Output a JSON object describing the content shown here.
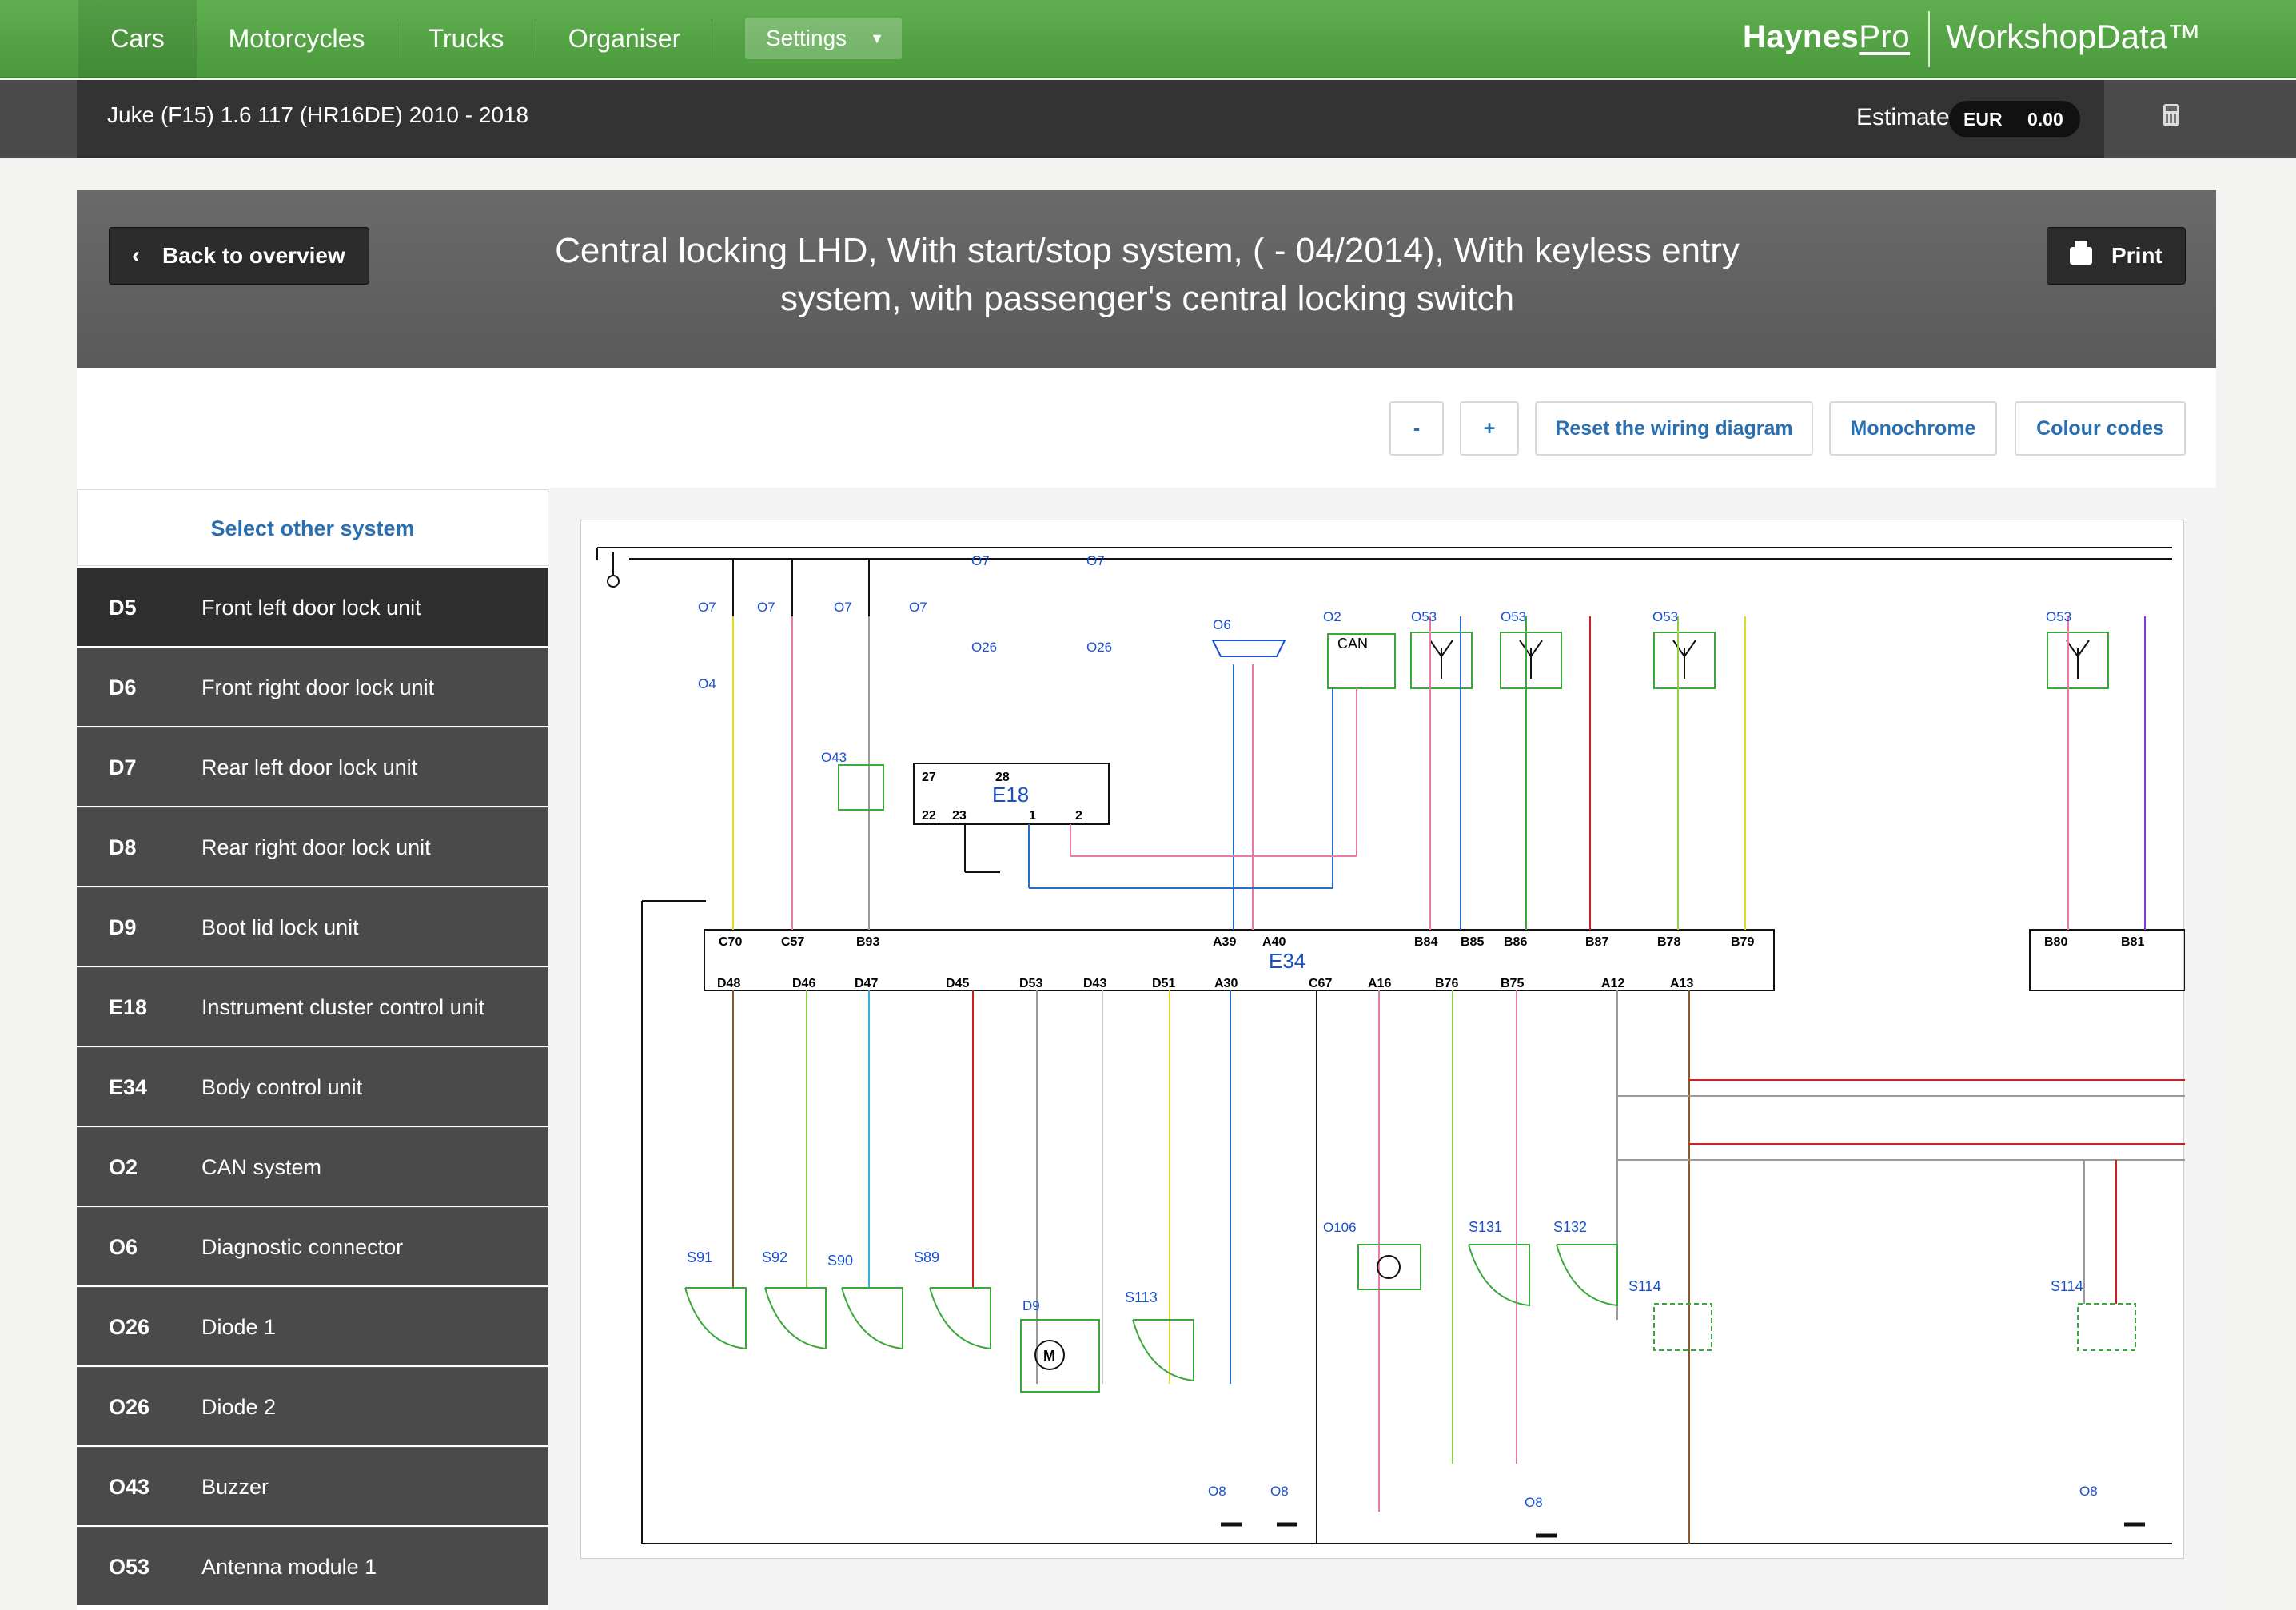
{
  "nav": {
    "items": [
      "Cars",
      "Motorcycles",
      "Trucks",
      "Organiser"
    ],
    "settings_label": "Settings",
    "brand_main": "Haynes",
    "brand_pro": "Pro",
    "brand_product": "WorkshopData™"
  },
  "vehicle": {
    "title": "Juke (F15) 1.6 117 (HR16DE) 2010 - 2018",
    "estimate_label": "Estimate",
    "currency": "EUR",
    "amount": "0.00"
  },
  "header": {
    "back_label": "Back to overview",
    "print_label": "Print",
    "title": "Central locking LHD, With start/stop system, ( - 04/2014), With keyless entry system, with passenger's central locking switch"
  },
  "toolbar": {
    "zoom_out": "-",
    "zoom_in": "+",
    "reset": "Reset the wiring diagram",
    "monochrome": "Monochrome",
    "colour_codes": "Colour codes"
  },
  "sidebar": {
    "select_other": "Select other system",
    "items": [
      {
        "code": "D5",
        "name": "Front left door lock unit"
      },
      {
        "code": "D6",
        "name": "Front right door lock unit"
      },
      {
        "code": "D7",
        "name": "Rear left door lock unit"
      },
      {
        "code": "D8",
        "name": "Rear right door lock unit"
      },
      {
        "code": "D9",
        "name": "Boot lid lock unit"
      },
      {
        "code": "E18",
        "name": "Instrument cluster control unit"
      },
      {
        "code": "E34",
        "name": "Body control unit"
      },
      {
        "code": "O2",
        "name": "CAN system"
      },
      {
        "code": "O6",
        "name": "Diagnostic connector"
      },
      {
        "code": "O26",
        "name": "Diode 1"
      },
      {
        "code": "O26",
        "name": "Diode 2"
      },
      {
        "code": "O43",
        "name": "Buzzer"
      },
      {
        "code": "O53",
        "name": "Antenna module 1"
      }
    ]
  },
  "diagram": {
    "e34_label": "E34",
    "e18_label": "E18",
    "can_label": "CAN",
    "top_pins": [
      "C70",
      "C57",
      "B93",
      "A39",
      "A40",
      "B84",
      "B85",
      "B86",
      "B87",
      "B78",
      "B79",
      "B80",
      "B81"
    ],
    "bottom_pins": [
      "D48",
      "D46",
      "D47",
      "D45",
      "D53",
      "D43",
      "D51",
      "A30",
      "C67",
      "A16",
      "B76",
      "B75",
      "A12",
      "A13"
    ],
    "e18_pins": [
      "27",
      "28",
      "22",
      "23",
      "1",
      "2"
    ],
    "switches": [
      "S91",
      "S92",
      "S90",
      "S89",
      "S113",
      "S131",
      "S132",
      "S114",
      "S114"
    ],
    "components": [
      "O7",
      "O7",
      "O7",
      "O7",
      "O7",
      "O7",
      "O6",
      "O2",
      "O53",
      "O53",
      "O53",
      "O53",
      "O26",
      "O26",
      "O43",
      "O4",
      "O8",
      "O8",
      "O8",
      "O8",
      "O106",
      "D9"
    ],
    "wire_colors": {
      "YE": "#e6d820",
      "PK": "#e87aa8",
      "GY": "#9a9a9a",
      "BU": "#2a6fd0",
      "BK": "#111111",
      "RD": "#cc2020",
      "GN": "#3aa83a",
      "LG": "#8fd14a",
      "LB": "#35b0e0",
      "VT": "#8a3ad0",
      "WH": "#c8c8c8",
      "BN": "#8a5a2a"
    }
  }
}
